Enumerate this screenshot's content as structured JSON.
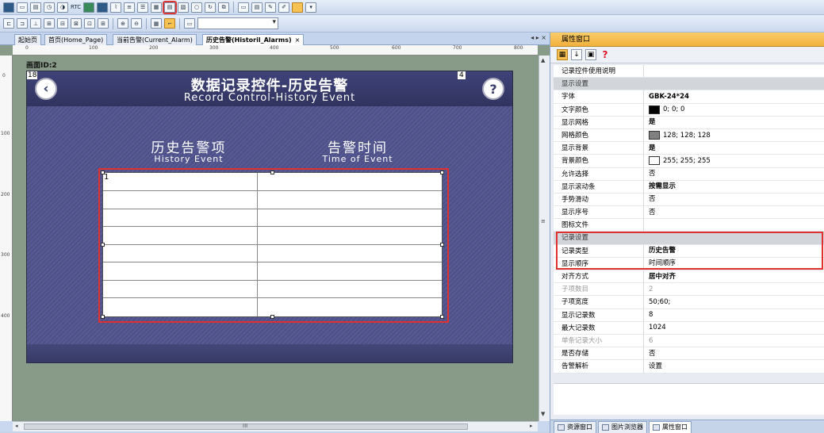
{
  "toolbar": {
    "rtc_label": "RTC"
  },
  "tabs": {
    "items": [
      {
        "label": "起始页",
        "active": false
      },
      {
        "label": "首页(Home_Page)",
        "active": false
      },
      {
        "label": "当前告警(Current_Alarm)",
        "active": false
      },
      {
        "label": "历史告警(Historil_Alarms)",
        "active": true
      }
    ],
    "close_glyph": "×",
    "nav": "◂ ▸ ×"
  },
  "designer": {
    "screen_label": "画面ID:2",
    "ruler_h": [
      "0",
      "100",
      "200",
      "300",
      "400",
      "500",
      "600",
      "700",
      "800"
    ],
    "ruler_v": [
      "0",
      "100",
      "200",
      "300",
      "400"
    ],
    "scroll_grip": "III"
  },
  "screen": {
    "badge_left": "18",
    "badge_right": "4",
    "back_glyph": "‹",
    "help_glyph": "?",
    "title_cn": "数据记录控件-历史告警",
    "title_en": "Record Control-History Event",
    "col1_cn": "历史告警项",
    "col1_en": "History Event",
    "col2_cn": "告警时间",
    "col2_en": "Time of Event",
    "grid_marker": "1"
  },
  "props": {
    "title": "属性窗口",
    "question": "?",
    "rows": [
      {
        "name": "记录控件使用说明",
        "value": ""
      },
      {
        "name": "显示设置",
        "section": true
      },
      {
        "name": "字体",
        "value": "GBK-24*24",
        "bold": true
      },
      {
        "name": "文字颜色",
        "value": "0; 0; 0",
        "swatch": "#000000"
      },
      {
        "name": "显示网格",
        "value": "是",
        "bold": true
      },
      {
        "name": "网格颜色",
        "value": "128; 128; 128",
        "swatch": "#808080"
      },
      {
        "name": "显示背景",
        "value": "是",
        "bold": true
      },
      {
        "name": "背景颜色",
        "value": "255; 255; 255",
        "swatch": "#ffffff"
      },
      {
        "name": "允许选择",
        "value": "否"
      },
      {
        "name": "显示滚动条",
        "value": "按需显示",
        "bold": true
      },
      {
        "name": "手势滑动",
        "value": "否"
      },
      {
        "name": "显示序号",
        "value": "否"
      },
      {
        "name": "图标文件",
        "value": ""
      },
      {
        "name": "记录设置",
        "section": true
      },
      {
        "name": "记录类型",
        "value": "历史告警",
        "bold": true
      },
      {
        "name": "显示顺序",
        "value": "时间顺序"
      },
      {
        "name": "对齐方式",
        "value": "居中对齐",
        "bold": true
      },
      {
        "name": "子项数目",
        "value": "2",
        "disabled": true
      },
      {
        "name": "子项宽度",
        "value": "50;60;"
      },
      {
        "name": "显示记录数",
        "value": "8"
      },
      {
        "name": "最大记录数",
        "value": "1024"
      },
      {
        "name": "单条记录大小",
        "value": "6",
        "disabled": true
      },
      {
        "name": "是否存储",
        "value": "否"
      },
      {
        "name": "告警解析",
        "value": "设置"
      }
    ],
    "bottom_tabs": [
      {
        "label": "资源窗口",
        "active": false
      },
      {
        "label": "图片浏览器",
        "active": false
      },
      {
        "label": "属性窗口",
        "active": true
      }
    ]
  },
  "colors": {
    "accent_red": "#e03030",
    "panel_title": "#f3b13d",
    "screen_bg": "#4f5288"
  }
}
